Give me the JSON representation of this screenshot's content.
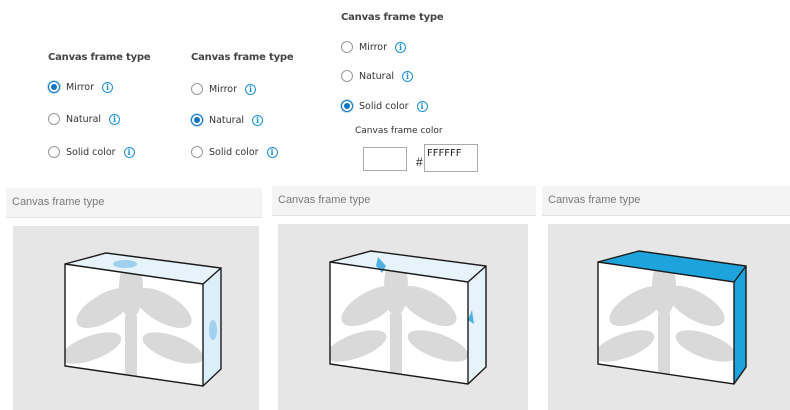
{
  "option_groups": [
    {
      "title": "Canvas frame type",
      "options": [
        {
          "label": "Mirror",
          "selected": true
        },
        {
          "label": "Natural",
          "selected": false
        },
        {
          "label": "Solid color",
          "selected": false
        }
      ]
    },
    {
      "title": "Canvas frame type",
      "options": [
        {
          "label": "Mirror",
          "selected": false
        },
        {
          "label": "Natural",
          "selected": true
        },
        {
          "label": "Solid color",
          "selected": false
        }
      ]
    },
    {
      "title": "Canvas frame type",
      "options": [
        {
          "label": "Mirror",
          "selected": false
        },
        {
          "label": "Natural",
          "selected": false
        },
        {
          "label": "Solid color",
          "selected": true
        }
      ],
      "color_field": {
        "label": "Canvas frame color",
        "hash": "#",
        "value": "FFFFFF"
      }
    }
  ],
  "info_icon": {
    "name": "info-icon",
    "glyph": "i"
  },
  "previews": [
    {
      "header": "Canvas frame type",
      "style": "mirror"
    },
    {
      "header": "Canvas frame type",
      "style": "natural"
    },
    {
      "header": "Canvas frame type",
      "style": "solid",
      "edge_color": "#1ea4dc"
    }
  ],
  "colors": {
    "accent": "#0a74c4",
    "info": "#1a90d8",
    "solid_edge": "#1ea4dc",
    "mirror_edge": "#dceef8",
    "panel_bg": "#e6e6e6"
  }
}
